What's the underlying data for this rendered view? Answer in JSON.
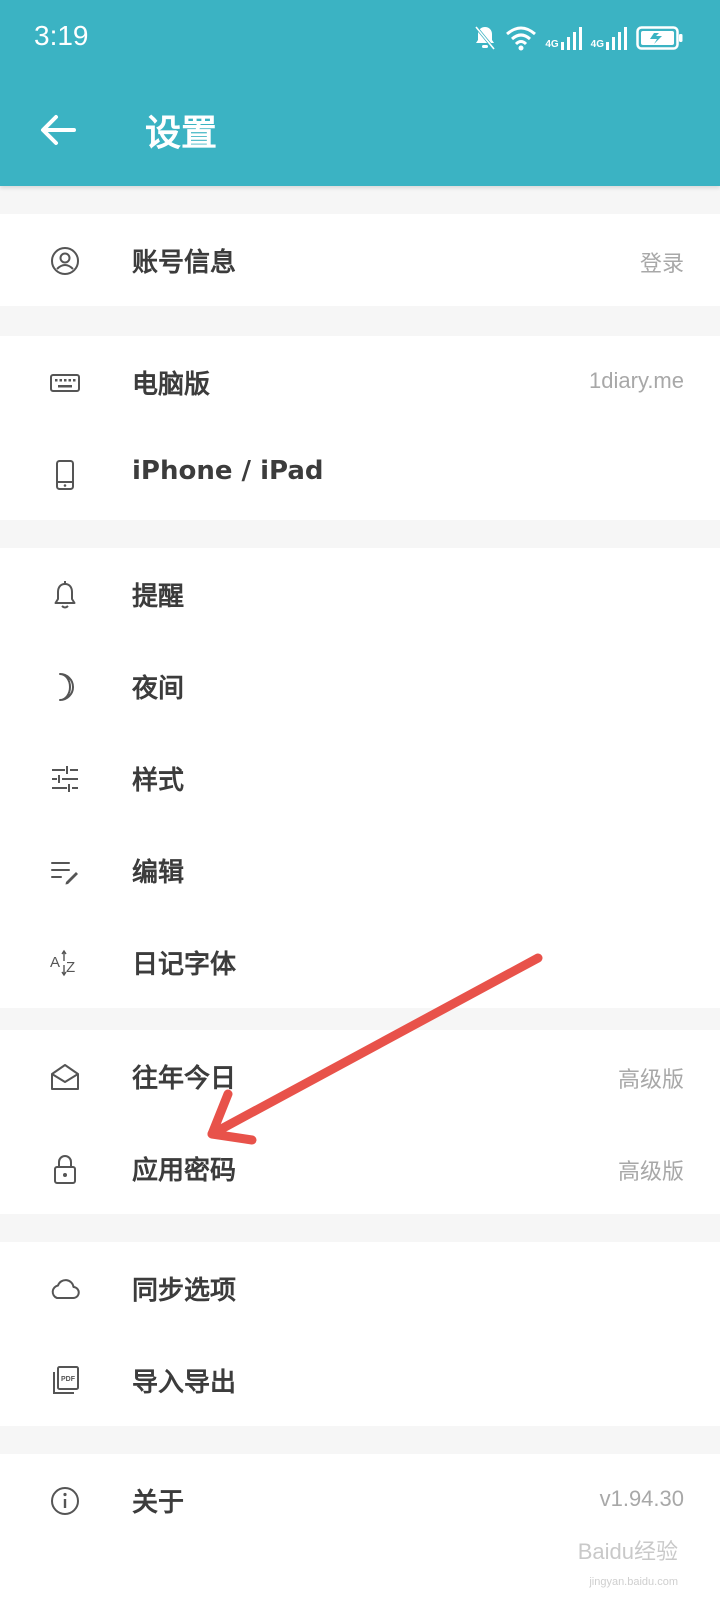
{
  "status_bar": {
    "time": "3:19",
    "net1": "4G",
    "net2": "4G"
  },
  "header": {
    "title": "设置",
    "color": "#3bb3c3"
  },
  "groups": [
    {
      "items": [
        {
          "label": "账号信息",
          "value": "登录",
          "icon": "account-circle-icon"
        }
      ]
    },
    {
      "items": [
        {
          "label": "电脑版",
          "value": "1diary.me",
          "icon": "keyboard-icon"
        },
        {
          "label": "iPhone / iPad",
          "value": "",
          "icon": "phone-icon"
        }
      ]
    },
    {
      "items": [
        {
          "label": "提醒",
          "value": "",
          "icon": "bell-icon"
        },
        {
          "label": "夜间",
          "value": "",
          "icon": "moon-icon"
        },
        {
          "label": "样式",
          "value": "",
          "icon": "sliders-icon"
        },
        {
          "label": "编辑",
          "value": "",
          "icon": "edit-lines-icon"
        },
        {
          "label": "日记字体",
          "value": "",
          "icon": "font-az-icon"
        }
      ]
    },
    {
      "items": [
        {
          "label": "往年今日",
          "value": "高级版",
          "icon": "mail-open-icon"
        },
        {
          "label": "应用密码",
          "value": "高级版",
          "icon": "lock-icon"
        }
      ]
    },
    {
      "items": [
        {
          "label": "同步选项",
          "value": "",
          "icon": "cloud-icon"
        },
        {
          "label": "导入导出",
          "value": "",
          "icon": "pdf-icon"
        }
      ]
    },
    {
      "items": [
        {
          "label": "关于",
          "value": "v1.94.30",
          "icon": "info-icon"
        }
      ]
    }
  ],
  "annotation": {
    "color": "#e8524a"
  },
  "watermark": {
    "text": "Baidu经验",
    "sub": "jingyan.baidu.com"
  }
}
